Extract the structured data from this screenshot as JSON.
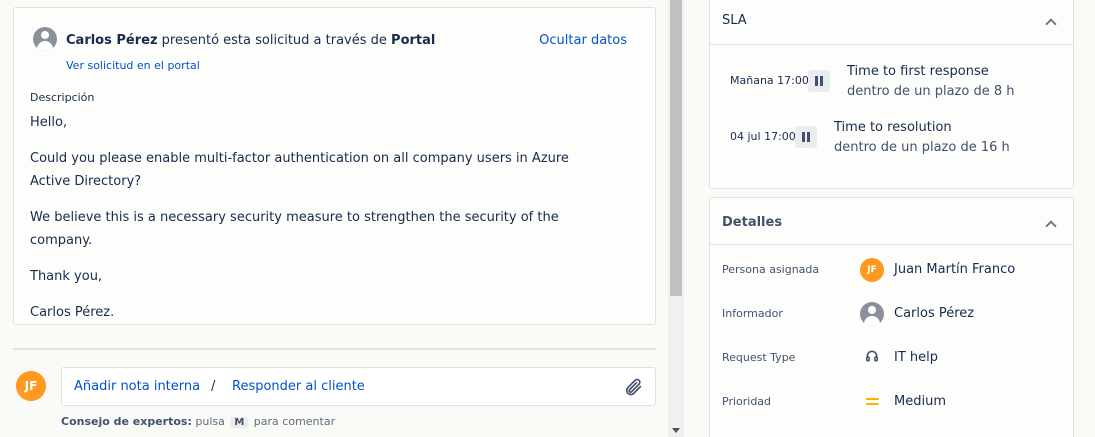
{
  "request": {
    "author": "Carlos Pérez",
    "presented_via": " presentó esta solicitud a través de ",
    "channel": "Portal",
    "hide_data_link": "Ocultar datos",
    "view_in_portal_link": "Ver solicitud en el portal",
    "description_label": "Descripción",
    "description_paragraphs": [
      "Hello,",
      "Could you please enable multi-factor authentication on all company users in Azure Active Directory?",
      "We believe this is a necessary security measure to strengthen the security of the company.",
      "Thank you,",
      "Carlos Pérez."
    ]
  },
  "comment": {
    "avatar_initials": "JF",
    "internal_note_link": "Añadir nota interna",
    "separator": "/",
    "reply_link": "Responder al cliente",
    "tip_label": "Consejo de expertos:",
    "tip_press": " pulsa ",
    "tip_key": "M",
    "tip_suffix": " para comentar",
    "attach_icon": "paperclip-icon"
  },
  "sla": {
    "title": "SLA",
    "items": [
      {
        "time": "Mañana 17:00",
        "name": "Time to first response",
        "sub": "dentro de un plazo de 8 h"
      },
      {
        "time": "04 jul 17:00",
        "name": "Time to resolution",
        "sub": "dentro de un plazo de 16 h"
      }
    ]
  },
  "details": {
    "title": "Detalles",
    "assignee_label": "Persona asignada",
    "assignee_initials": "JF",
    "assignee_value": "Juan Martín Franco",
    "reporter_label": "Informador",
    "reporter_value": "Carlos Pérez",
    "request_type_label": "Request Type",
    "request_type_value": "IT help",
    "priority_label": "Prioridad",
    "priority_value": "Medium"
  },
  "colors": {
    "link": "#0052cc",
    "avatar_orange": "#ff991f",
    "priority_medium": "#ffab00"
  }
}
